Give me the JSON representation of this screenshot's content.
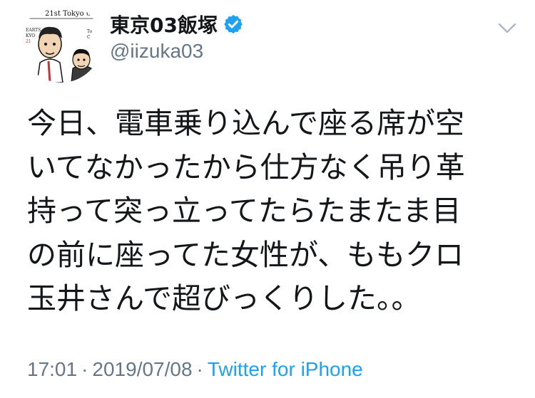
{
  "tweet": {
    "avatar": {
      "caption_line1": "21st Tokyo 03",
      "caption_small_left": "EARTS\nKYO",
      "caption_small_right": "To\nC"
    },
    "user": {
      "display_name": "東京03飯塚",
      "handle": "@iizuka03",
      "verified": true
    },
    "text_lines": [
      "今日、電車乗り込んで座る席が空",
      "いてなかったから仕方なく吊り革",
      "持って突っ立ってたらたまたま目",
      "の前に座ってた女性が、ももクロ",
      "玉井さんで超びっくりした。。"
    ],
    "meta": {
      "time": "17:01",
      "separator": "·",
      "date": "2019/07/08",
      "source": "Twitter for iPhone"
    },
    "colors": {
      "text": "#14171a",
      "secondary": "#657786",
      "accent": "#1da1f2"
    },
    "icons": {
      "verified": "verified-badge-icon",
      "menu": "chevron-down-icon"
    }
  }
}
